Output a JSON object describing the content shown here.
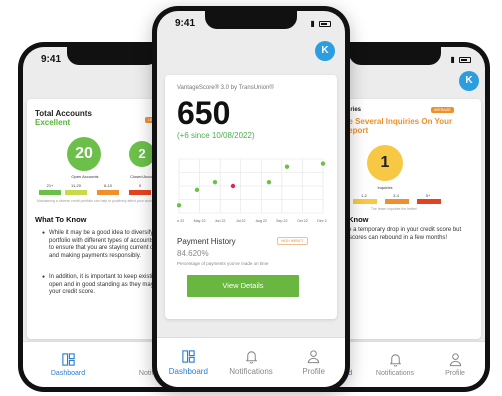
{
  "status": {
    "time": "9:41"
  },
  "avatar": {
    "initial": "K"
  },
  "tabs": {
    "dashboard": "Dashboard",
    "notifications": "Notifications",
    "profile": "Profile"
  },
  "left": {
    "title": "Total Accounts",
    "rating": "Excellent",
    "badge": "LEFT",
    "open_count": "20",
    "open_label": "Open Accounts",
    "closed_count": "2",
    "closed_label": "Closed Accounts",
    "scale": [
      "21+",
      "11-20",
      "6-10",
      "0"
    ],
    "note": "Maintaining a diverse credit portfolio can help to positively affect your score.",
    "what_title": "What To Know",
    "bullets": [
      "While it may be a good idea to diversify your credit portfolio with different types of accounts, it is important to ensure that you are staying current on your accounts and making payments responsibly.",
      "In addition, it is important to keep existing accounts open and in good standing as they may positively affect your credit score."
    ]
  },
  "center": {
    "score_label": "VantageScore® 3.0 by TransUnion®",
    "score": "650",
    "change": "(+6 since 10/08/2022)",
    "payment_title": "Payment History",
    "payment_badge": "HIGH IMPACT",
    "payment_pct": "84.620%",
    "payment_desc": "Percentage of payments you've made on time",
    "button": "View Details"
  },
  "right": {
    "title": "Credit Inquiries",
    "badge": "AVERAGE",
    "headline": "You Have Several Inquiries On Your Credit Report",
    "count": "1",
    "count_label": "Inquiries",
    "scale": [
      "0",
      "1-2",
      "3-4",
      "5+"
    ],
    "note": "The fewer inquiries the better!",
    "what_title": "What To Know",
    "body": "You may see a temporary drop in your credit score but don't worry, scores can rebound in a few months!"
  },
  "colors": {
    "green": "#6cc04a",
    "yellow": "#f7c844",
    "orange": "#f0902b",
    "red": "#e5431f",
    "accent": "#2a7fd4"
  },
  "chart_data": {
    "type": "scatter",
    "x_ticks": [
      "Apr 22",
      "May 22",
      "Jun 22",
      "Jul 22",
      "Aug 22",
      "Sep 22",
      "Oct 22",
      "Dec 22"
    ],
    "points": [
      {
        "x": 0,
        "y": 1,
        "color": "#6cc04a"
      },
      {
        "x": 1,
        "y": 3,
        "color": "#6cc04a"
      },
      {
        "x": 2,
        "y": 4,
        "color": "#6cc04a"
      },
      {
        "x": 3,
        "y": 3.5,
        "color": "#e0245e"
      },
      {
        "x": 5,
        "y": 4,
        "color": "#6cc04a"
      },
      {
        "x": 6,
        "y": 6,
        "color": "#6cc04a"
      },
      {
        "x": 8,
        "y": 6.4,
        "color": "#6cc04a"
      }
    ],
    "xlim": [
      0,
      8
    ],
    "ylim": [
      0,
      7
    ],
    "grid": true
  }
}
